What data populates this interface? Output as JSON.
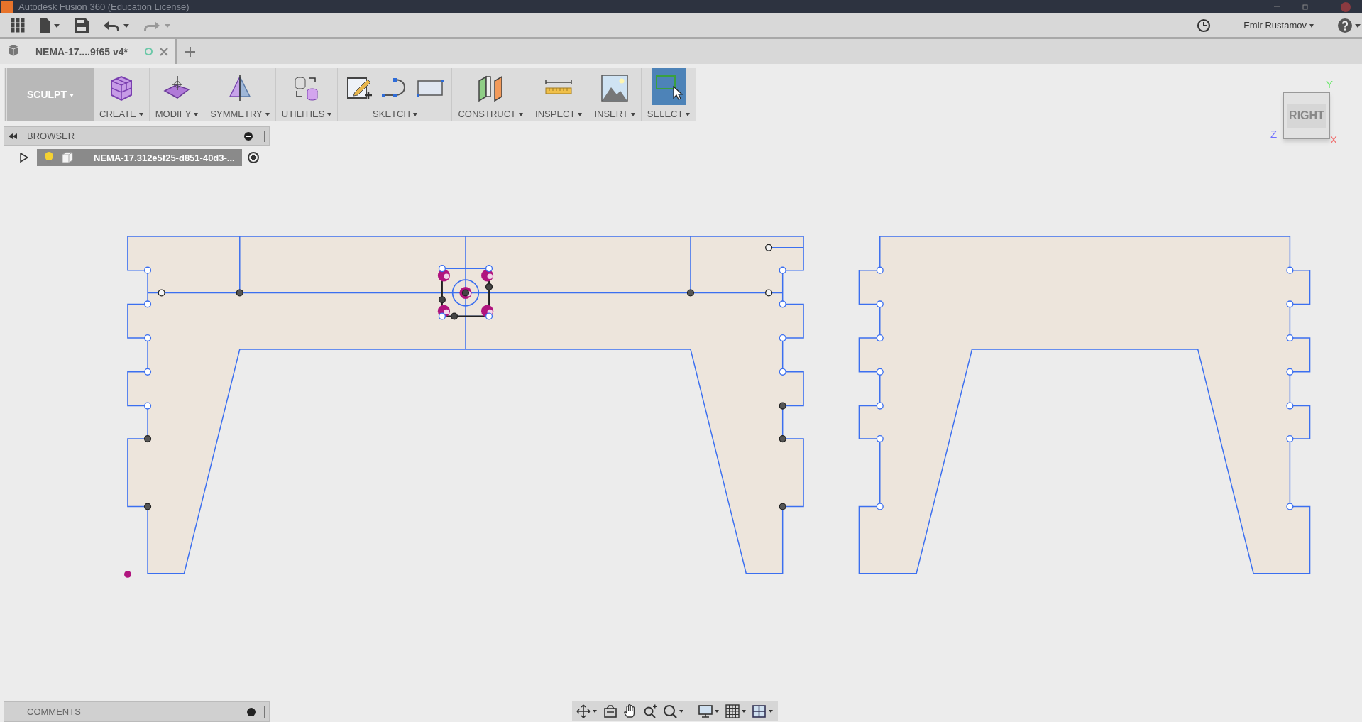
{
  "window": {
    "title": "Autodesk Fusion 360 (Education License)"
  },
  "quick_bar": {
    "user": "Emir Rustamov"
  },
  "document_tabs": [
    {
      "title": "NEMA-17....9f65 v4*",
      "selected": true
    }
  ],
  "toolbar": {
    "workspace": "SCULPT",
    "groups": [
      {
        "label": "CREATE",
        "icons": [
          {
            "kind": "box"
          }
        ],
        "active": false
      },
      {
        "label": "MODIFY",
        "icons": [
          {
            "kind": "surface"
          }
        ],
        "active": false
      },
      {
        "label": "SYMMETRY",
        "icons": [
          {
            "kind": "mirror"
          }
        ],
        "active": false
      },
      {
        "label": "UTILITIES",
        "icons": [
          {
            "kind": "convert"
          }
        ],
        "active": false
      },
      {
        "label": "SKETCH",
        "icons": [
          {
            "kind": "sketch"
          },
          {
            "kind": "spline"
          },
          {
            "kind": "rectangle"
          }
        ],
        "active": false
      },
      {
        "label": "CONSTRUCT",
        "icons": [
          {
            "kind": "plane"
          }
        ],
        "active": false
      },
      {
        "label": "INSPECT",
        "icons": [
          {
            "kind": "ruler"
          }
        ],
        "active": false
      },
      {
        "label": "INSERT",
        "icons": [
          {
            "kind": "picture"
          }
        ],
        "active": false
      },
      {
        "label": "SELECT",
        "icons": [
          {
            "kind": "select"
          }
        ],
        "active": true
      }
    ]
  },
  "browser": {
    "title": "BROWSER",
    "items": [
      {
        "label": "NEMA-17.312e5f25-d851-40d3-...",
        "selected": true
      }
    ]
  },
  "view_cube": {
    "face": "RIGHT",
    "axes": [
      {
        "label": "Y",
        "color": "#6ee86e"
      },
      {
        "label": "Z",
        "color": "#7070ff"
      },
      {
        "label": "X",
        "color": "#f07070"
      }
    ]
  },
  "comments": {
    "title": "COMMENTS"
  }
}
